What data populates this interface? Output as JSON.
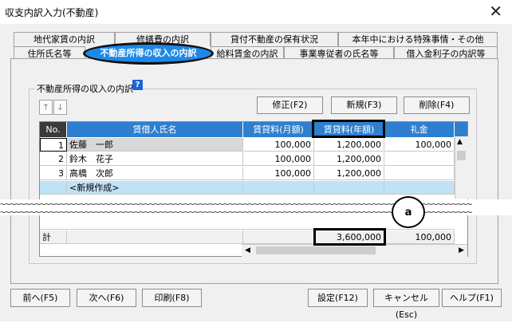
{
  "window": {
    "title": "収支内訳入力(不動産)",
    "close_glyph": "✕"
  },
  "tabs_back": [
    "地代家賃の内訳",
    "修繕費の内訳",
    "貸付不動産の保有状況",
    "本年中における特殊事情・その他"
  ],
  "tabs_front": [
    "住所氏名等",
    "不動産所得の収入の内訳",
    "給料賃金の内訳",
    "事業専従者の氏名等",
    "借入金利子の内訳等"
  ],
  "group": {
    "title": "不動産所得の収入の内訳",
    "help": "?"
  },
  "move_buttons": [
    "↑",
    "↓"
  ],
  "actions": [
    "修正(F2)",
    "新規(F3)",
    "削除(F4)"
  ],
  "table": {
    "headers": [
      "No.",
      "賃借人氏名",
      "賃貸料(月額)",
      "賃貸料(年額)",
      "礼金"
    ],
    "rows": [
      {
        "no": "1",
        "name": "佐藤　一郎",
        "monthly": "100,000",
        "annual": "1,200,000",
        "key_money": "100,000"
      },
      {
        "no": "2",
        "name": "鈴木　花子",
        "monthly": "100,000",
        "annual": "1,200,000",
        "key_money": ""
      },
      {
        "no": "3",
        "name": "高橋　次郎",
        "monthly": "100,000",
        "annual": "1,200,000",
        "key_money": ""
      }
    ],
    "new_row": "<新規作成>",
    "total_label": "計",
    "total_annual": "3,600,000",
    "total_key_money": "100,000"
  },
  "callout": "a",
  "bottom_buttons": [
    "前へ(F5)",
    "次へ(F6)",
    "印刷(F8)",
    "設定(F12)",
    "キャンセル(Esc)",
    "ヘルプ(F1)"
  ],
  "colors": {
    "header_blue": "#2f7fd0",
    "selected_tab": "#1f88e5",
    "new_row": "#bfe2f6"
  }
}
